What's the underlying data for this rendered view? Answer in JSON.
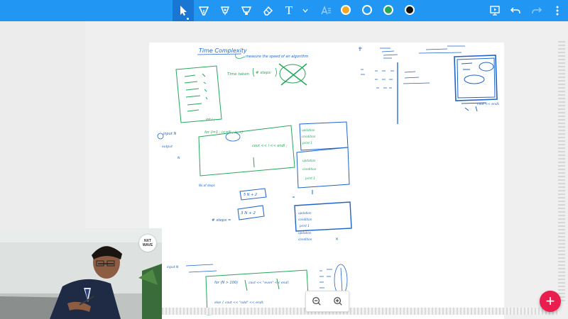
{
  "toolbar": {
    "colors": {
      "bar": "#2196f3",
      "active": "#1976d2",
      "orange": "#f5a623",
      "blue": "#1e63c9",
      "green": "#26a65b",
      "black": "#111111"
    },
    "tools": [
      "select-tool",
      "pen-tool",
      "fountain-pen-tool",
      "highlighter-tool",
      "eraser-tool",
      "text-tool",
      "text-options-dropdown",
      "text-format-tool"
    ],
    "text_tool_glyph": "T",
    "right_actions": [
      "present",
      "undo",
      "redo",
      "more"
    ]
  },
  "board": {
    "title": "Time Complexity",
    "subtitle": "measure the speed of an algorithm",
    "notes": {
      "time_taken": "Time taken",
      "steps": "# steps",
      "int_i": "int i ;",
      "for_loop": "for (i=1 ; i<=N ; i++)",
      "cout": "cout << i << endl ;",
      "input_n": "input N",
      "output": "output",
      "n_val": "N",
      "steps_formula": "# steps =",
      "five_n": "5 N + 2",
      "three_n": "3 N + 2",
      "ok_mark": "×",
      "for_n": "for (N > 100)",
      "cout_even": "cout << \"even\" << endl;",
      "else_line": "else { cout << \"odd\" << endl;",
      "condition": "condition",
      "print": "print 1",
      "updation": "updation",
      "no_of_steps": "No of steps",
      "cout_endl": "cout << endl;"
    }
  },
  "logo": {
    "line1": "NXT",
    "line2": "WAVE"
  },
  "zoom": {
    "out_label": "zoom out",
    "in_label": "zoom in"
  },
  "fab": {
    "label": "+"
  }
}
